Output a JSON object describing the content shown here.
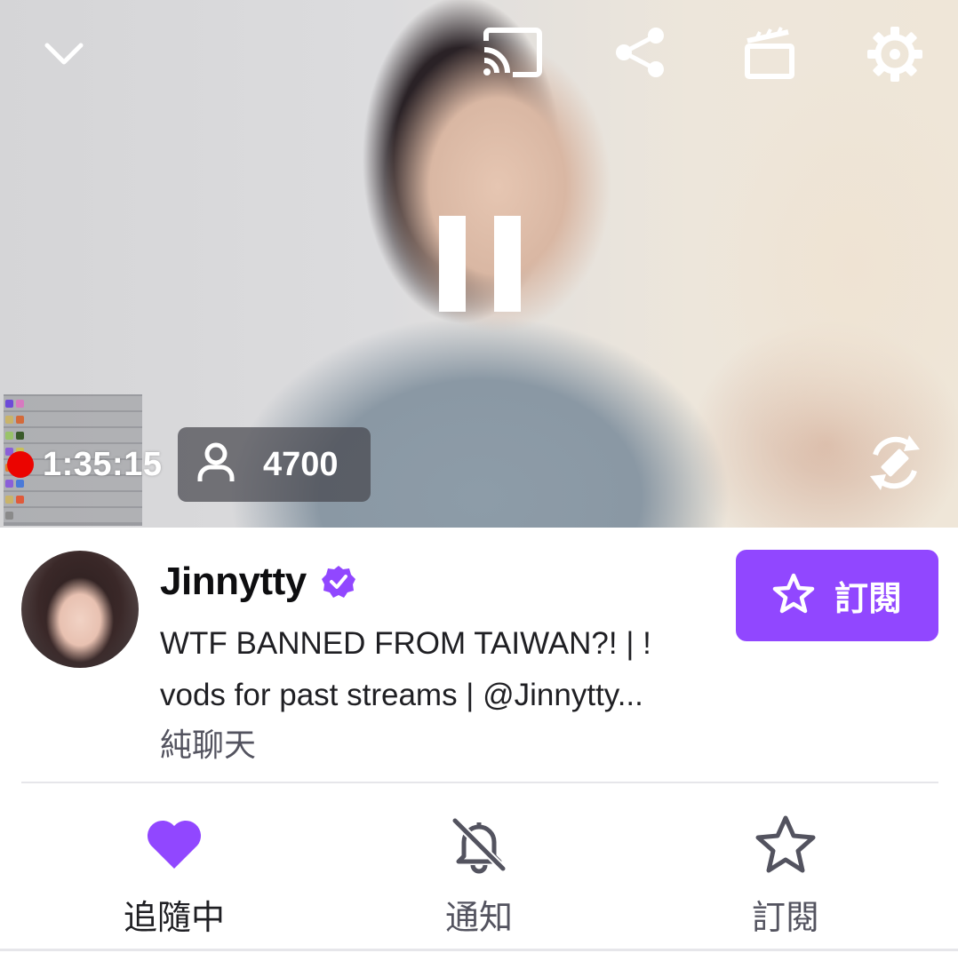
{
  "player": {
    "icons": {
      "collapse": "chevron-down-icon",
      "cast": "cast-icon",
      "share": "share-icon",
      "clip": "clapperboard-icon",
      "settings": "gear-icon",
      "pause": "pause-icon",
      "rotate": "rotate-screen-icon"
    },
    "uptime": "1:35:15",
    "viewer_count": "4700",
    "live_color": "#eb0400"
  },
  "channel": {
    "name": "Jinnytty",
    "verified": true,
    "title_line1": "WTF BANNED FROM TAIWAN?! | !",
    "title_line2": "vods for past streams | @Jinnytty...",
    "category": "純聊天",
    "subscribe_label": "訂閱"
  },
  "actions": [
    {
      "label": "追隨中",
      "icon": "heart-icon",
      "color": "#9147ff"
    },
    {
      "label": "通知",
      "icon": "bell-off-icon",
      "color": "#53535f"
    },
    {
      "label": "訂閱",
      "icon": "star-icon",
      "color": "#53535f"
    }
  ],
  "colors": {
    "brand_purple": "#9147ff",
    "text_primary": "#0e0e10",
    "text_secondary": "#53535f"
  }
}
